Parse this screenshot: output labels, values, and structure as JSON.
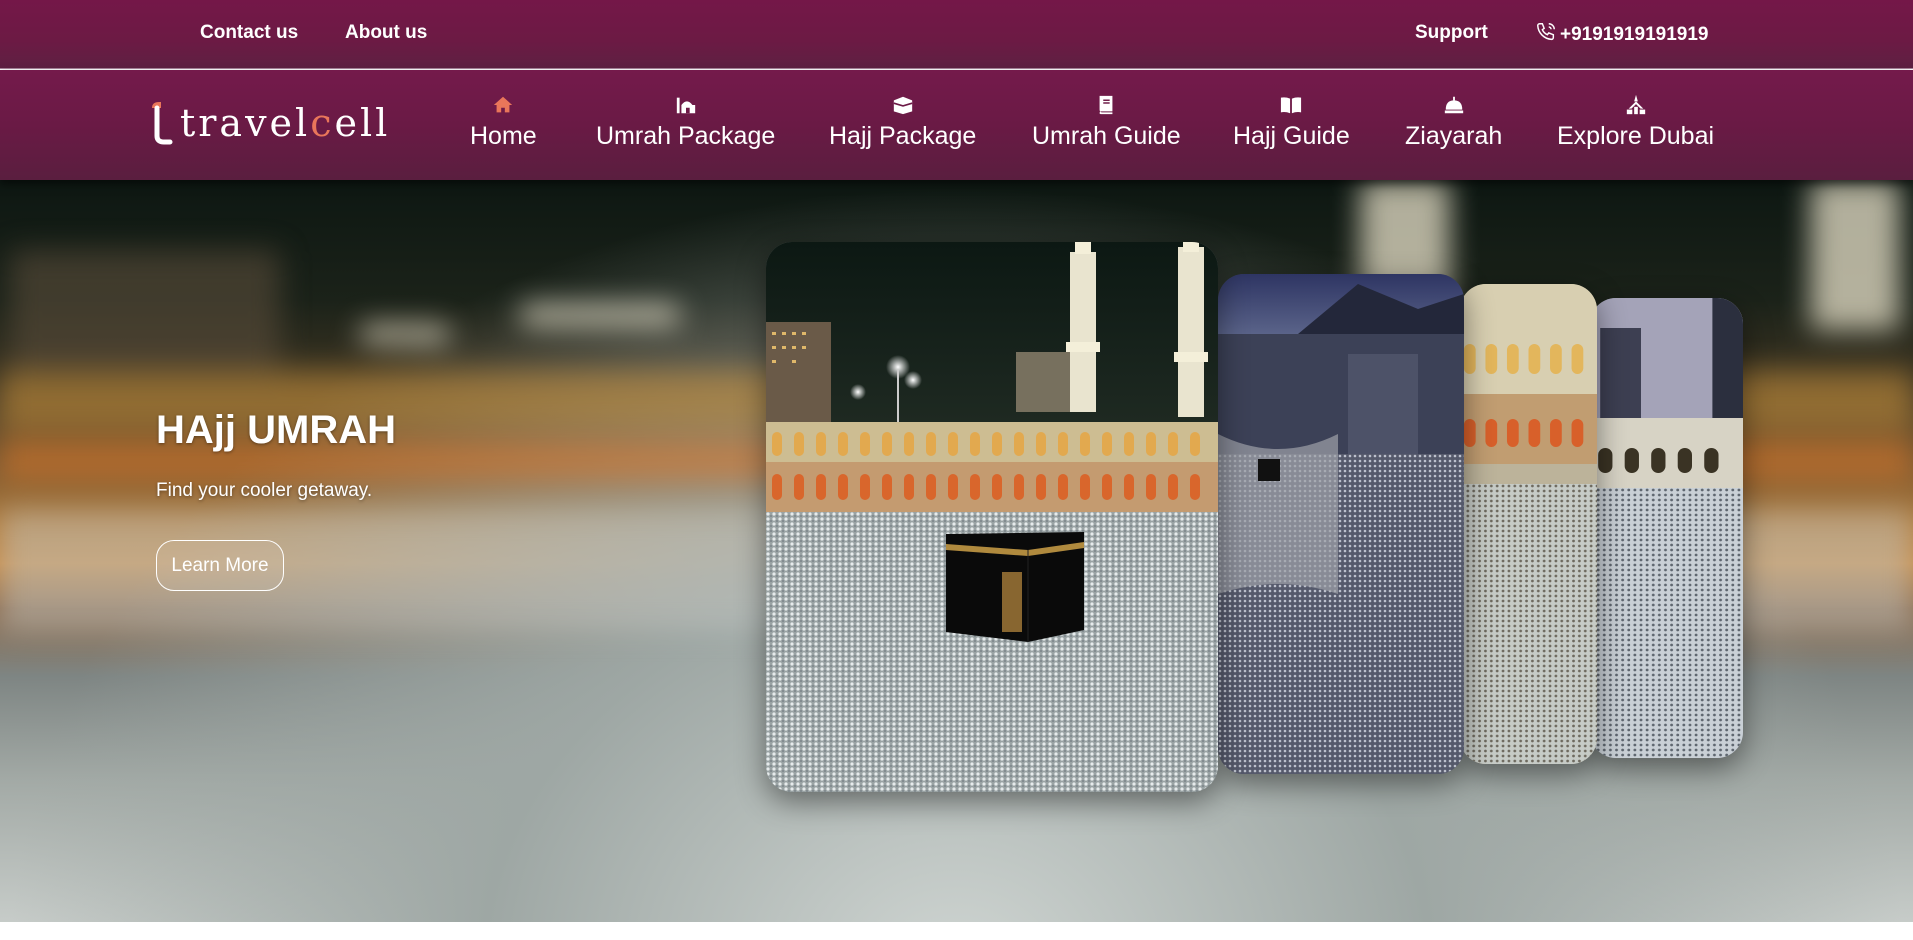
{
  "topbar": {
    "contact": "Contact us",
    "about": "About us",
    "support": "Support",
    "phone": "+9191919191919",
    "phone_icon": "phone-icon"
  },
  "brand": {
    "logo_prefix": "travel",
    "logo_accent": "c",
    "logo_suffix": "ell",
    "accent_color": "#e9765a",
    "primary_color": "#6d1a47"
  },
  "nav": {
    "items": [
      {
        "label": "Home",
        "icon": "home-icon",
        "active": true
      },
      {
        "label": "Umrah Package",
        "icon": "mosque-icon"
      },
      {
        "label": "Hajj Package",
        "icon": "kaaba-icon"
      },
      {
        "label": "Umrah Guide",
        "icon": "book-icon"
      },
      {
        "label": "Hajj Guide",
        "icon": "book-open-icon"
      },
      {
        "label": "Ziayarah",
        "icon": "dome-icon"
      },
      {
        "label": "Explore Dubai",
        "icon": "landmark-icon"
      }
    ]
  },
  "hero": {
    "title": "HAjj UMRAH",
    "subtitle": "Find your cooler getaway.",
    "button": "Learn More"
  }
}
